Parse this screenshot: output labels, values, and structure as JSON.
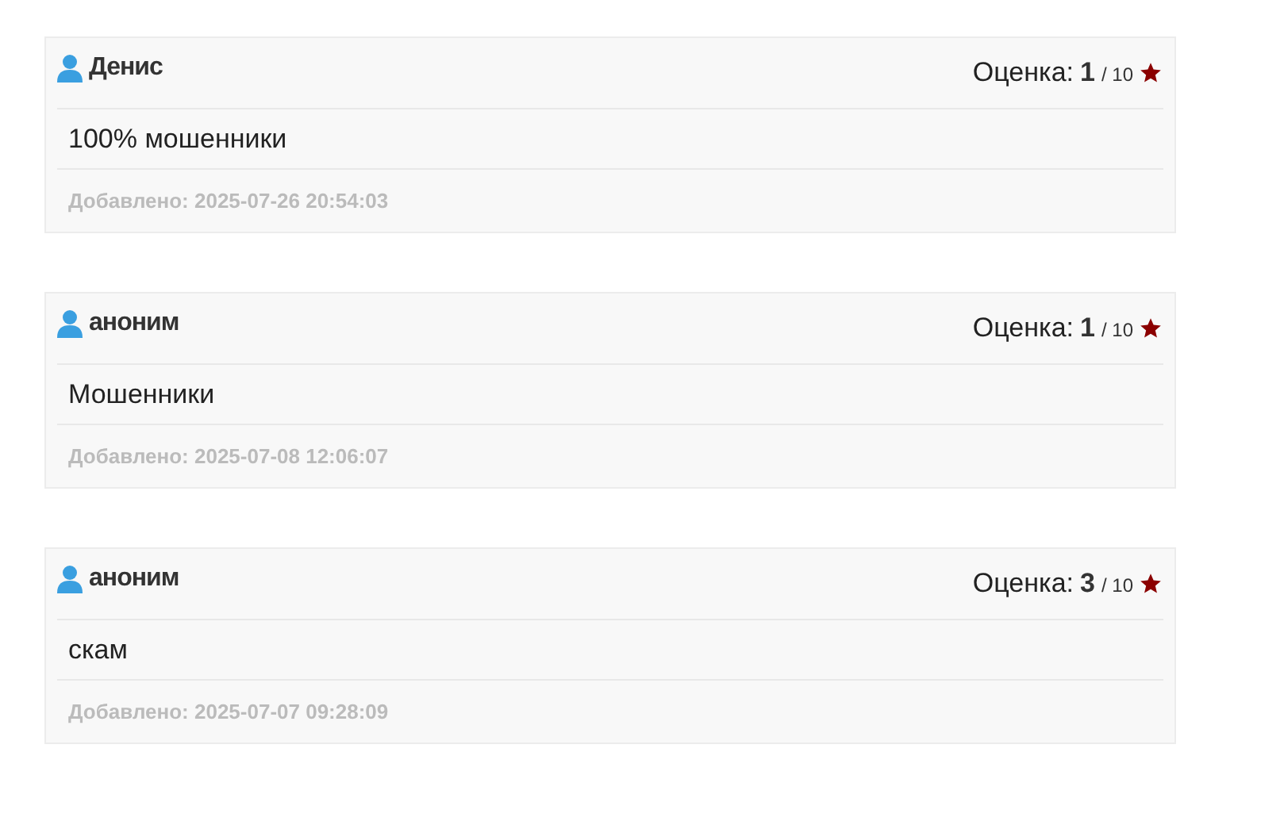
{
  "reviews": [
    {
      "author": "Денис",
      "rating_label": "Оценка:",
      "rating": "1",
      "rating_max": "/ 10",
      "text": "100% мошенники",
      "added": "Добавлено: 2025-07-26 20:54:03"
    },
    {
      "author": "аноним",
      "rating_label": "Оценка:",
      "rating": "1",
      "rating_max": "/ 10",
      "text": "Мошенники",
      "added": "Добавлено: 2025-07-08 12:06:07"
    },
    {
      "author": "аноним",
      "rating_label": "Оценка:",
      "rating": "3",
      "rating_max": "/ 10",
      "text": "скам",
      "added": "Добавлено: 2025-07-07 09:28:09"
    }
  ]
}
